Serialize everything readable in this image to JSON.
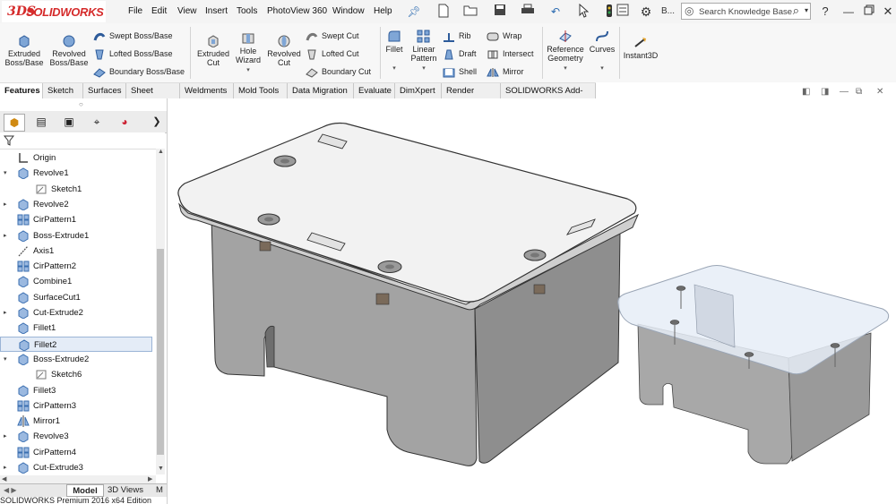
{
  "app": {
    "logo_text": "SOLIDWORKS",
    "logo_mark": "3DS",
    "brand_color": "#d52b2b"
  },
  "menu": [
    "File",
    "Edit",
    "View",
    "Insert",
    "Tools",
    "PhotoView 360",
    "Window",
    "Help"
  ],
  "quick_access": {
    "icons": [
      "pin-icon",
      "new-icon",
      "open-icon",
      "save-icon",
      "print-icon",
      "undo-icon",
      "select-icon",
      "traffic-light-icon",
      "options-icon",
      "settings-icon"
    ],
    "truncated_label": "B..."
  },
  "search": {
    "placeholder": "Search Knowledge Base"
  },
  "help_icon": "?",
  "window_controls": [
    "minimize",
    "restore",
    "close"
  ],
  "ribbon": {
    "extruded_boss": "Extruded Boss/Base",
    "revolved_boss": "Revolved Boss/Base",
    "swept_boss": "Swept Boss/Base",
    "lofted_boss": "Lofted Boss/Base",
    "boundary_boss": "Boundary Boss/Base",
    "extruded_cut": "Extruded Cut",
    "hole_wizard": "Hole Wizard",
    "revolved_cut": "Revolved Cut",
    "swept_cut": "Swept Cut",
    "lofted_cut": "Lofted Cut",
    "boundary_cut": "Boundary Cut",
    "fillet": "Fillet",
    "linear_pattern": "Linear Pattern",
    "rib": "Rib",
    "draft": "Draft",
    "shell": "Shell",
    "wrap": "Wrap",
    "intersect": "Intersect",
    "mirror": "Mirror",
    "reference_geometry": "Reference Geometry",
    "curves": "Curves",
    "instant3d": "Instant3D"
  },
  "tabs": [
    "Features",
    "Sketch",
    "Surfaces",
    "Sheet Metal",
    "Weldments",
    "Mold Tools",
    "Data Migration",
    "Evaluate",
    "DimXpert",
    "Render Tools",
    "SOLIDWORKS Add-Ins"
  ],
  "active_tab": "Features",
  "tree": [
    {
      "label": "Origin",
      "icon": "origin-icon",
      "expand": "",
      "indent": 0
    },
    {
      "label": "Revolve1",
      "icon": "revolve-icon",
      "expand": "▾",
      "indent": 0
    },
    {
      "label": "Sketch1",
      "icon": "sketch-icon",
      "expand": "",
      "indent": 1
    },
    {
      "label": "Revolve2",
      "icon": "revolve-icon",
      "expand": "▸",
      "indent": 0
    },
    {
      "label": "CirPattern1",
      "icon": "pattern-icon",
      "expand": "",
      "indent": 0
    },
    {
      "label": "Boss-Extrude1",
      "icon": "extrude-icon",
      "expand": "▸",
      "indent": 0
    },
    {
      "label": "Axis1",
      "icon": "axis-icon",
      "expand": "",
      "indent": 0
    },
    {
      "label": "CirPattern2",
      "icon": "pattern-icon",
      "expand": "",
      "indent": 0
    },
    {
      "label": "Combine1",
      "icon": "combine-icon",
      "expand": "",
      "indent": 0
    },
    {
      "label": "SurfaceCut1",
      "icon": "surface-cut-icon",
      "expand": "",
      "indent": 0
    },
    {
      "label": "Cut-Extrude2",
      "icon": "cut-extrude-icon",
      "expand": "▸",
      "indent": 0
    },
    {
      "label": "Fillet1",
      "icon": "fillet-icon",
      "expand": "",
      "indent": 0
    },
    {
      "label": "Fillet2",
      "icon": "fillet-icon",
      "expand": "",
      "indent": 0,
      "selected": true
    },
    {
      "label": "Boss-Extrude2",
      "icon": "extrude-icon",
      "expand": "▾",
      "indent": 0
    },
    {
      "label": "Sketch6",
      "icon": "sketch-icon",
      "expand": "",
      "indent": 1
    },
    {
      "label": "Fillet3",
      "icon": "fillet-icon",
      "expand": "",
      "indent": 0
    },
    {
      "label": "CirPattern3",
      "icon": "pattern-icon",
      "expand": "",
      "indent": 0
    },
    {
      "label": "Mirror1",
      "icon": "mirror-icon",
      "expand": "",
      "indent": 0
    },
    {
      "label": "Revolve3",
      "icon": "revolve-icon",
      "expand": "▸",
      "indent": 0
    },
    {
      "label": "CirPattern4",
      "icon": "pattern-icon",
      "expand": "",
      "indent": 0
    },
    {
      "label": "Cut-Extrude3",
      "icon": "cut-extrude-icon",
      "expand": "▸",
      "indent": 0
    }
  ],
  "bottom_tabs": {
    "model": "Model",
    "views3d": "3D Views",
    "motion": "M"
  },
  "status_text": "SOLIDWORKS Premium 2016 x64 Edition",
  "model_colors": {
    "body": "#9b9b9b",
    "top": "#f2f2f2",
    "transparent_lid": "#e6edf7"
  }
}
